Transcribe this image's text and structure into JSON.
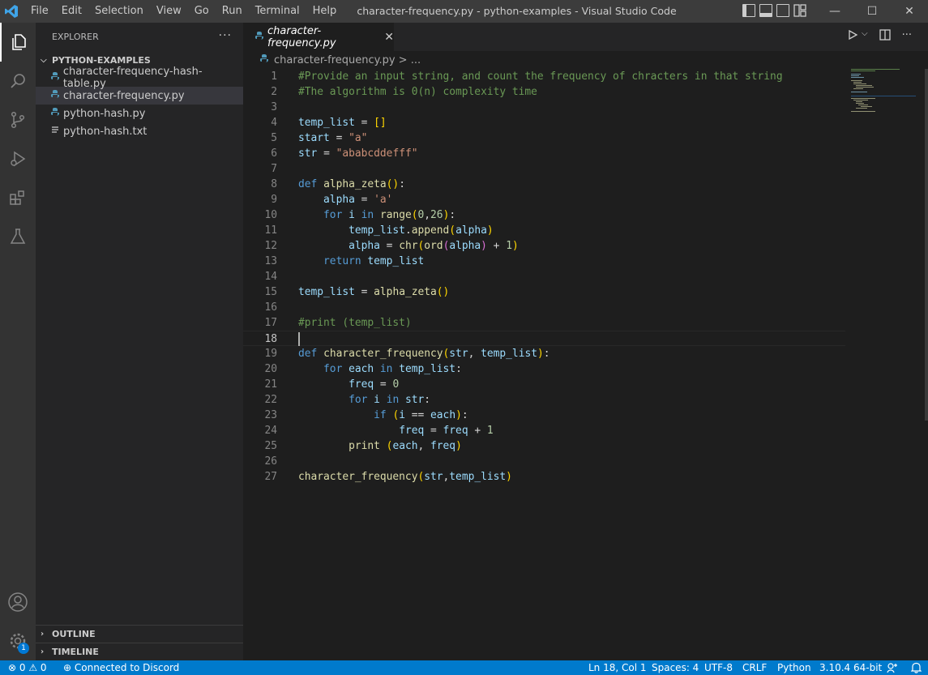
{
  "titlebar": {
    "menu": [
      "File",
      "Edit",
      "Selection",
      "View",
      "Go",
      "Run",
      "Terminal",
      "Help"
    ],
    "title": "character-frequency.py - python-examples - Visual Studio Code",
    "minimize": "—",
    "maximize": "☐",
    "close": "✕"
  },
  "sidebar": {
    "header": "EXPLORER",
    "more": "···",
    "folder": "PYTHON-EXAMPLES",
    "files": [
      {
        "name": "character-frequency-hash-table.py",
        "type": "python"
      },
      {
        "name": "character-frequency.py",
        "type": "python"
      },
      {
        "name": "python-hash.py",
        "type": "python"
      },
      {
        "name": "python-hash.txt",
        "type": "text"
      }
    ],
    "outline": "OUTLINE",
    "timeline": "TIMELINE"
  },
  "activity": {
    "badge": "1"
  },
  "editor": {
    "tab_label": "character-frequency.py",
    "tab_close": "✕",
    "breadcrumb": "character-frequency.py > ...",
    "line_numbers": [
      "1",
      "2",
      "3",
      "4",
      "5",
      "6",
      "7",
      "8",
      "9",
      "10",
      "11",
      "12",
      "13",
      "14",
      "15",
      "16",
      "17",
      "18",
      "19",
      "20",
      "21",
      "22",
      "23",
      "24",
      "25",
      "26",
      "27"
    ]
  },
  "statusbar": {
    "problems": "⊗ 0 ⚠ 0",
    "discord": "Connected to Discord",
    "position": "Ln 18, Col 1",
    "spaces": "Spaces: 4",
    "encoding": "UTF-8",
    "eol": "CRLF",
    "language": "Python",
    "interpreter": "3.10.4 64-bit"
  },
  "colors": {
    "accent": "#007acc",
    "titlebar": "#3c3c3c",
    "sidebar": "#252526",
    "editor": "#1e1e1e"
  }
}
